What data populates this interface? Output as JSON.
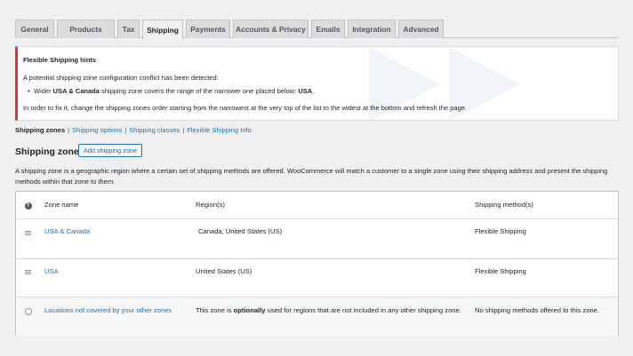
{
  "tabs": [
    "General",
    "Products",
    "Tax",
    "Shipping",
    "Payments",
    "Accounts & Privacy",
    "Emails",
    "Integration",
    "Advanced"
  ],
  "active_tab": "Shipping",
  "notice": {
    "title": "Flexible Shipping hints",
    "line1": "A potential shipping zone configuration conflict has been detected:",
    "bullet_pre": "Wider ",
    "bullet_zone": "USA & Canada",
    "bullet_mid": " shipping zone covers the range of the narrower one placed below: ",
    "bullet_narrow": "USA",
    "bullet_end": ".",
    "line3": "In order to fix it, change the shipping zones order starting from the narrowest at the very top of the list to the widest at the bottom and refresh the page."
  },
  "subnav": {
    "current": "Shipping zones",
    "links": [
      "Shipping options",
      "Shipping classes",
      "Flexible Shipping Info"
    ],
    "sep": "|"
  },
  "zones_heading": "Shipping zones",
  "add_button": "Add shipping zone",
  "description": "A shipping zone is a geographic region where a certain set of shipping methods are offered. WooCommerce will match a customer to a single zone using their shipping address and present the shipping methods within that zone to them.",
  "table": {
    "help": "?",
    "headers": {
      "name": "Zone name",
      "regions": "Region(s)",
      "methods": "Shipping method(s)"
    },
    "rows": [
      {
        "name": "USA & Canada",
        "regions": "Canada, United States (US)",
        "methods": "Flexible Shipping"
      },
      {
        "name": "USA",
        "regions": "United States (US)",
        "methods": "Flexible Shipping"
      }
    ],
    "fallback": {
      "name": "Locations not covered by your other zones",
      "regions_pre": "This zone is ",
      "regions_bold": "optionally",
      "regions_post": " used for regions that are not included in any other shipping zone.",
      "methods": "No shipping methods offered to this zone."
    }
  },
  "colors": {
    "accent": "#2271b1",
    "error": "#d63638",
    "background": "#f0f0f1"
  }
}
